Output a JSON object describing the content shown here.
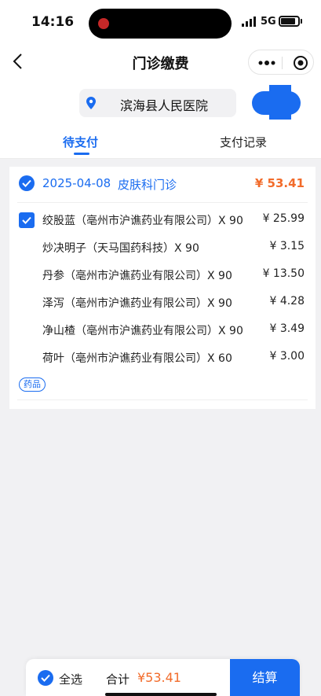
{
  "status_bar": {
    "time": "14:16",
    "network": "5G"
  },
  "nav": {
    "title": "门诊缴费",
    "back_icon": "chevron-left-icon",
    "more_icon": "more-dots-icon",
    "close_icon": "target-circle-icon"
  },
  "hospital": {
    "name": "滨海县人民医院",
    "icon": "location-pin-icon"
  },
  "tabs": [
    {
      "label": "待支付",
      "active": true
    },
    {
      "label": "支付记录",
      "active": false
    }
  ],
  "visit": {
    "date": "2025-04-08",
    "department": "皮肤科门诊",
    "total": "¥ 53.41",
    "items": [
      {
        "name": "绞股蓝（亳州市沪谯药业有限公司）X 90",
        "price": "¥ 25.99"
      },
      {
        "name": "炒决明子（天马国药科技）X 90",
        "price": "¥ 3.15"
      },
      {
        "name": "丹参（亳州市沪谯药业有限公司）X 90",
        "price": "¥ 13.50"
      },
      {
        "name": "泽泻（亳州市沪谯药业有限公司）X 90",
        "price": "¥ 4.28"
      },
      {
        "name": "净山楂（亳州市沪谯药业有限公司）X 90",
        "price": "¥ 3.49"
      },
      {
        "name": "荷叶（亳州市沪谯药业有限公司）X 60",
        "price": "¥ 3.00"
      }
    ],
    "tag": "药品"
  },
  "bottom_bar": {
    "select_all": "全选",
    "total_label": "合计",
    "total_amount": "¥53.41",
    "checkout": "结算"
  },
  "colors": {
    "accent": "#1a6cf0",
    "price_orange": "#f26b2a",
    "background": "#f1f1f3"
  }
}
